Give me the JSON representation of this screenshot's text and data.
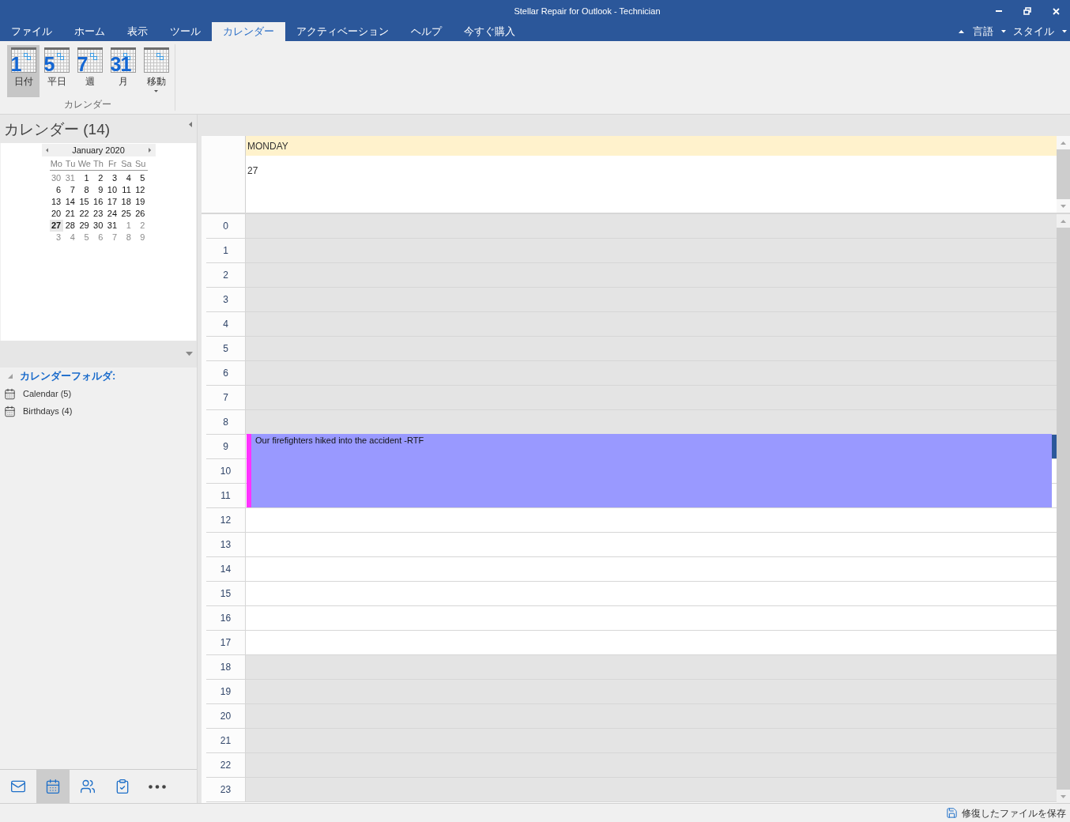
{
  "window": {
    "title": "Stellar Repair for Outlook - Technician"
  },
  "menu_tabs": [
    {
      "label": "ファイル",
      "selected": false
    },
    {
      "label": "ホーム",
      "selected": false
    },
    {
      "label": "表示",
      "selected": false
    },
    {
      "label": "ツール",
      "selected": false
    },
    {
      "label": "カレンダー",
      "selected": true
    },
    {
      "label": "アクティベーション",
      "selected": false
    },
    {
      "label": "ヘルプ",
      "selected": false
    },
    {
      "label": "今すぐ購入",
      "selected": false
    }
  ],
  "menu_right": [
    {
      "kind": "collapse"
    },
    {
      "kind": "menu",
      "label": "言語"
    },
    {
      "kind": "menu",
      "label": "スタイル"
    }
  ],
  "ribbon": {
    "buttons": [
      {
        "label": "日付",
        "icon_text": "1",
        "selected": true,
        "dropdown": false
      },
      {
        "label": "平日",
        "icon_text": "5",
        "selected": false,
        "dropdown": false
      },
      {
        "label": "週",
        "icon_text": "7",
        "selected": false,
        "dropdown": false
      },
      {
        "label": "月",
        "icon_text": "31",
        "selected": false,
        "dropdown": false
      },
      {
        "label": "移動",
        "selected": false,
        "dropdown": true
      }
    ],
    "group_label": "カレンダー"
  },
  "sidebar": {
    "title": "カレンダー (14)",
    "mini_calendar": {
      "month": "January 2020",
      "weekdays": [
        "Mo",
        "Tu",
        "We",
        "Th",
        "Fr",
        "Sa",
        "Su"
      ],
      "weeks": [
        [
          {
            "day": "30",
            "in_month": false,
            "selected": false
          },
          {
            "day": "31",
            "in_month": false,
            "selected": false
          },
          {
            "day": "1",
            "in_month": true,
            "selected": false
          },
          {
            "day": "2",
            "in_month": true,
            "selected": false
          },
          {
            "day": "3",
            "in_month": true,
            "selected": false
          },
          {
            "day": "4",
            "in_month": true,
            "selected": false
          },
          {
            "day": "5",
            "in_month": true,
            "selected": false
          }
        ],
        [
          {
            "day": "6",
            "in_month": true,
            "selected": false
          },
          {
            "day": "7",
            "in_month": true,
            "selected": false
          },
          {
            "day": "8",
            "in_month": true,
            "selected": false
          },
          {
            "day": "9",
            "in_month": true,
            "selected": false
          },
          {
            "day": "10",
            "in_month": true,
            "selected": false
          },
          {
            "day": "11",
            "in_month": true,
            "selected": false
          },
          {
            "day": "12",
            "in_month": true,
            "selected": false
          }
        ],
        [
          {
            "day": "13",
            "in_month": true,
            "selected": false
          },
          {
            "day": "14",
            "in_month": true,
            "selected": false
          },
          {
            "day": "15",
            "in_month": true,
            "selected": false
          },
          {
            "day": "16",
            "in_month": true,
            "selected": false
          },
          {
            "day": "17",
            "in_month": true,
            "selected": false
          },
          {
            "day": "18",
            "in_month": true,
            "selected": false
          },
          {
            "day": "19",
            "in_month": true,
            "selected": false
          }
        ],
        [
          {
            "day": "20",
            "in_month": true,
            "selected": false
          },
          {
            "day": "21",
            "in_month": true,
            "selected": false
          },
          {
            "day": "22",
            "in_month": true,
            "selected": false
          },
          {
            "day": "23",
            "in_month": true,
            "selected": false
          },
          {
            "day": "24",
            "in_month": true,
            "selected": false
          },
          {
            "day": "25",
            "in_month": true,
            "selected": false
          },
          {
            "day": "26",
            "in_month": true,
            "selected": false
          }
        ],
        [
          {
            "day": "27",
            "in_month": true,
            "selected": true
          },
          {
            "day": "28",
            "in_month": true,
            "selected": false
          },
          {
            "day": "29",
            "in_month": true,
            "selected": false
          },
          {
            "day": "30",
            "in_month": true,
            "selected": false
          },
          {
            "day": "31",
            "in_month": true,
            "selected": false
          },
          {
            "day": "1",
            "in_month": false,
            "selected": false
          },
          {
            "day": "2",
            "in_month": false,
            "selected": false
          }
        ],
        [
          {
            "day": "3",
            "in_month": false,
            "selected": false
          },
          {
            "day": "4",
            "in_month": false,
            "selected": false
          },
          {
            "day": "5",
            "in_month": false,
            "selected": false
          },
          {
            "day": "6",
            "in_month": false,
            "selected": false
          },
          {
            "day": "7",
            "in_month": false,
            "selected": false
          },
          {
            "day": "8",
            "in_month": false,
            "selected": false
          },
          {
            "day": "9",
            "in_month": false,
            "selected": false
          }
        ]
      ]
    },
    "folders": {
      "title": "カレンダーフォルダ:",
      "expanded": true,
      "items": [
        {
          "label": "Calendar (5)"
        },
        {
          "label": "Birthdays (4)"
        }
      ]
    },
    "nav": [
      {
        "kind": "mail",
        "selected": false
      },
      {
        "kind": "calendar",
        "selected": true
      },
      {
        "kind": "contacts",
        "selected": false
      },
      {
        "kind": "tasks",
        "selected": false
      },
      {
        "kind": "more",
        "selected": false
      }
    ]
  },
  "day_view": {
    "day_name": "MONDAY",
    "date": "27",
    "event": {
      "title": "Our firefighters hiked into the accident -RTF"
    },
    "hours": [
      {
        "label": "0",
        "working": false,
        "busy": false
      },
      {
        "label": "1",
        "working": false,
        "busy": false
      },
      {
        "label": "2",
        "working": false,
        "busy": false
      },
      {
        "label": "3",
        "working": false,
        "busy": false
      },
      {
        "label": "4",
        "working": false,
        "busy": false
      },
      {
        "label": "5",
        "working": false,
        "busy": false
      },
      {
        "label": "6",
        "working": false,
        "busy": false
      },
      {
        "label": "7",
        "working": false,
        "busy": false
      },
      {
        "label": "8",
        "working": false,
        "busy": false
      },
      {
        "label": "9",
        "working": true,
        "busy": true
      },
      {
        "label": "10",
        "working": true,
        "busy": true
      },
      {
        "label": "11",
        "working": true,
        "busy": true
      },
      {
        "label": "12",
        "working": true,
        "busy": false
      },
      {
        "label": "13",
        "working": true,
        "busy": false
      },
      {
        "label": "14",
        "working": true,
        "busy": false
      },
      {
        "label": "15",
        "working": true,
        "busy": false
      },
      {
        "label": "16",
        "working": true,
        "busy": false
      },
      {
        "label": "17",
        "working": true,
        "busy": false
      },
      {
        "label": "18",
        "working": false,
        "busy": false
      },
      {
        "label": "19",
        "working": false,
        "busy": false
      },
      {
        "label": "20",
        "working": false,
        "busy": false
      },
      {
        "label": "21",
        "working": false,
        "busy": false
      },
      {
        "label": "22",
        "working": false,
        "busy": false
      },
      {
        "label": "23",
        "working": false,
        "busy": false
      }
    ]
  },
  "status_bar": {
    "save_button": "修復したファイルを保存"
  }
}
